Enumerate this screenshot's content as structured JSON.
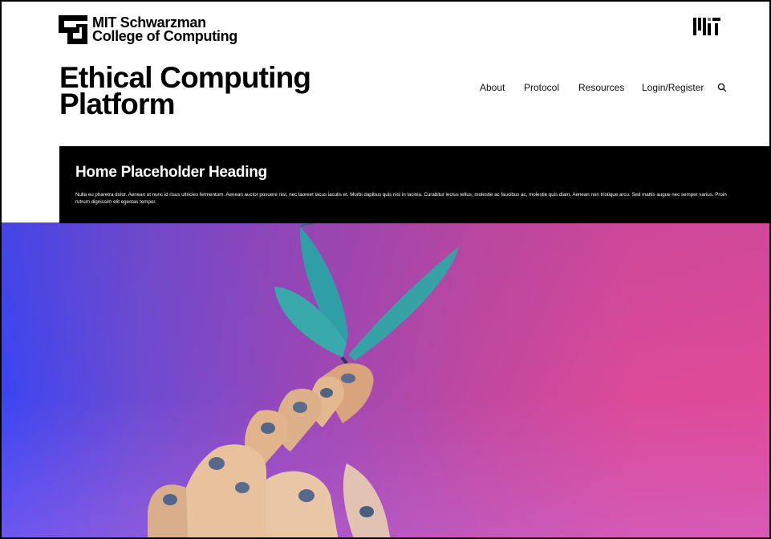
{
  "brand": {
    "name_line1": "MIT Schwarzman",
    "name_line2": "College of Computing",
    "logo_icon": "schwarzman-college-logo-icon",
    "mit_logo_icon": "mit-logo-icon"
  },
  "site": {
    "title_line1": "Ethical Computing",
    "title_line2": "Platform"
  },
  "nav": {
    "items": [
      {
        "label": "About"
      },
      {
        "label": "Protocol"
      },
      {
        "label": "Resources"
      },
      {
        "label": "Login/Register"
      }
    ],
    "search_icon": "search-icon"
  },
  "intro": {
    "heading": "Home Placeholder Heading",
    "text": "Nulla eu pharetra dolor. Aenean ut nunc id risus ultricies fermentum. Aenean auctor posuere nisl, nec laoreet lacus iaculis et. Morbi dapibus quis nisi in lacinia. Curabitur lectus tellus, molestie ac faucibus ac, molestie quis diam. Aenean non tristique arcu. Sed mattis augue nec semper varius. Proin rutrum dignissim elit egestas tempor."
  },
  "hero": {
    "image_subject": "robot-hand-holding-butterfly",
    "colors": {
      "left": "#3b45f2",
      "mid": "#9747b8",
      "right": "#e04a98",
      "butterfly": "#3aa6a8"
    }
  },
  "colors": {
    "text": "#000000",
    "intro_bg": "#000000",
    "intro_text": "#ffffff"
  }
}
